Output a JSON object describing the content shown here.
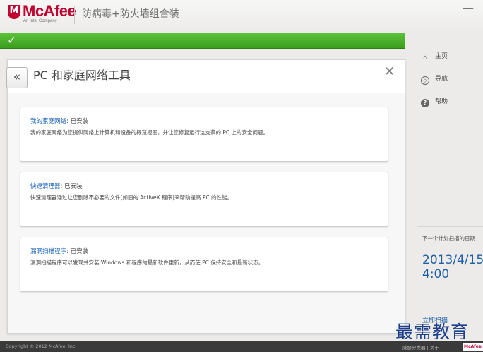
{
  "header": {
    "brand": "McAfee",
    "brand_sub": "An Intel Company",
    "product": "防病毒+防火墙组合装",
    "minimize": "—"
  },
  "status": {
    "check": "✓",
    "color": "#4cb22b"
  },
  "panel": {
    "back": "«",
    "title": "PC 和家庭网络工具",
    "close": "✕",
    "cards": [
      {
        "name": "我的家庭网络",
        "status": ": 已安装",
        "desc": "我的家庭网络为您提供网络上计算机和设备的概览视图，并让您修复运行这支萘的 PC 上的安全问题。"
      },
      {
        "name": "快速清理器",
        "status": ": 已安装",
        "desc": "快速清理器通过让您删除不必要的文件(如旧的 ActiveX 程序)来帮助提高 PC 的性能。"
      },
      {
        "name": "漏洞扫描程序",
        "status": ": 已安装",
        "desc": "漏洞扫描程序可以发现并安装 Windows 和程序的最新软件更新，从而使 PC 保持安全和最新状态。"
      }
    ]
  },
  "nav": {
    "home": "主页",
    "navigation": "导航",
    "help": "帮助"
  },
  "schedule": {
    "label": "下一个计划扫描的日期",
    "date": "2013/4/15",
    "time": "4:00",
    "link": "立即扫描"
  },
  "footer": {
    "copyright": "Copyright © 2012 McAfee, Inc.",
    "links": "威胁分类器 | 关于",
    "badge": "McAfee"
  },
  "watermark": "最需教育"
}
